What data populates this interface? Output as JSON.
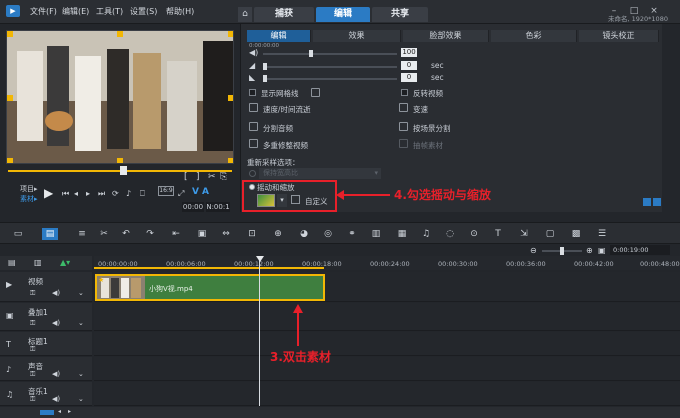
{
  "menubar": {
    "items": [
      "文件(F)",
      "编辑(E)",
      "工具(T)",
      "设置(S)",
      "帮助(H)"
    ],
    "project_info": "未命名, 1920*1080"
  },
  "tabs": [
    "捕获",
    "编辑",
    "共享"
  ],
  "options": {
    "subtabs": [
      "编辑",
      "效果",
      "脸部效果",
      "色彩",
      "镜头校正"
    ],
    "small_text": "0:00:00:00",
    "volume_value": "100",
    "fade_in_value": "0",
    "fade_out_value": "0",
    "sec_label": "sec",
    "show_grid": "显示网格线",
    "reverse_video": "反转视频",
    "speed_time": "速度/时间流逝",
    "variable_speed": "变速",
    "split_audio": "分割音频",
    "split_by_scene": "按场景分割",
    "multi_trim": "多重修整视频",
    "smart_proxy": "抽帧素材",
    "resample_label": "重新采样选项：",
    "resample_dropdown": "保持宽高比",
    "pan_zoom": "摇动和缩放",
    "custom": "自定义"
  },
  "preview": {
    "project_label": "项目▸",
    "clip_label": "素材▸",
    "timecode": "00:00",
    "frame_code": "N:00:1"
  },
  "timeline": {
    "ruler": [
      "00:00:00:00",
      "00:00:06:00",
      "00:00:12:00",
      "00:00:18:00",
      "00:00:24:00",
      "00:00:30:00",
      "00:00:36:00",
      "00:00:42:00",
      "00:00:48:00"
    ],
    "zoom_time": "0:00:19:00",
    "tracks": [
      "视频",
      "叠加1",
      "标题1",
      "声音",
      "音乐1"
    ],
    "clip_name": "小狗V视.mp4"
  },
  "annotations": {
    "step4": "4.勾选摇动与缩放",
    "step3": "3.双击素材"
  },
  "colors": {
    "accent_blue": "#2b7bc4",
    "annotation_red": "#e8202a",
    "clip_green": "#3f7f3f",
    "handle_yellow": "#f2b705"
  }
}
